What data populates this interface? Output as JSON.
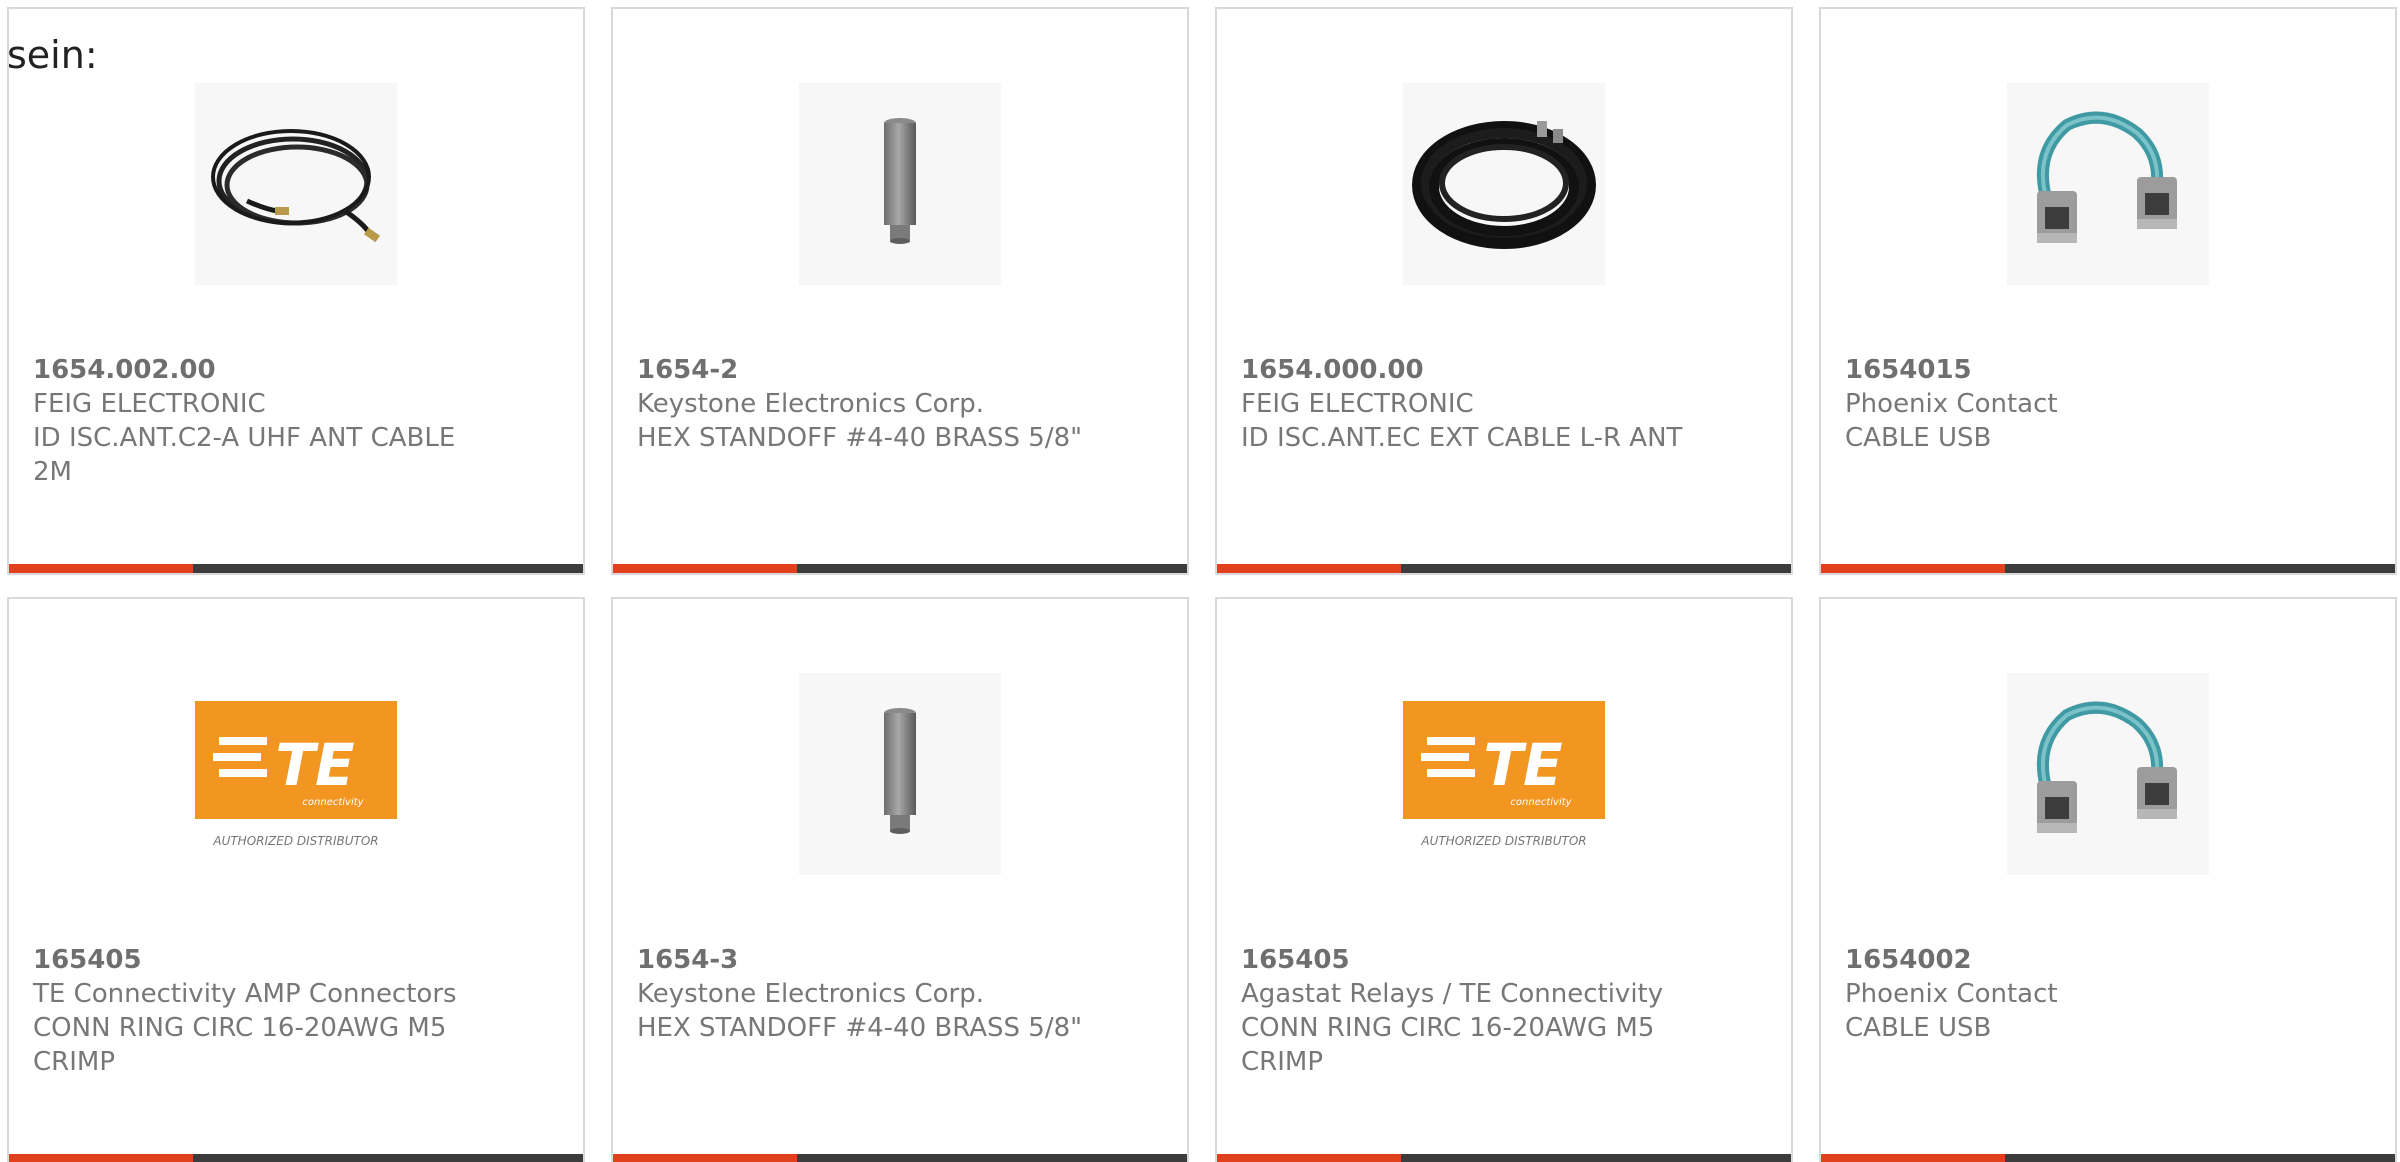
{
  "lead_text": "sein:",
  "colors": {
    "accent_bar": "#e0401b",
    "bar": "#3c3c3c",
    "card_border": "#d9d9d9",
    "text": "#777777"
  },
  "products": [
    {
      "part_number": "1654.002.00",
      "manufacturer": "FEIG ELECTRONIC",
      "description": "ID ISC.ANT.C2-A UHF ANT CABLE 2M",
      "image": "coiled-cable-thin-icon"
    },
    {
      "part_number": "1654-2",
      "manufacturer": "Keystone Electronics Corp.",
      "description": "HEX STANDOFF #4-40 BRASS 5/8\"",
      "image": "hex-standoff-icon"
    },
    {
      "part_number": "1654.000.00",
      "manufacturer": "FEIG ELECTRONIC",
      "description": "ID ISC.ANT.EC EXT CABLE L-R ANT",
      "image": "coiled-cable-thick-icon"
    },
    {
      "part_number": "1654015",
      "manufacturer": "Phoenix Contact",
      "description": "CABLE USB",
      "image": "usb-cable-icon"
    },
    {
      "part_number": "165405",
      "manufacturer": "TE Connectivity AMP Connectors",
      "description": "CONN RING CIRC 16-20AWG M5 CRIMP",
      "image": "te-logo",
      "logo_text": {
        "brand": "TE",
        "sub": "connectivity",
        "caption": "AUTHORIZED DISTRIBUTOR"
      }
    },
    {
      "part_number": "1654-3",
      "manufacturer": "Keystone Electronics Corp.",
      "description": "HEX STANDOFF #4-40 BRASS 5/8\"",
      "image": "hex-standoff-icon"
    },
    {
      "part_number": "165405",
      "manufacturer": "Agastat Relays / TE Connectivity",
      "description": "CONN RING CIRC 16-20AWG M5 CRIMP",
      "image": "te-logo",
      "logo_text": {
        "brand": "TE",
        "sub": "connectivity",
        "caption": "AUTHORIZED DISTRIBUTOR"
      }
    },
    {
      "part_number": "1654002",
      "manufacturer": "Phoenix Contact",
      "description": "CABLE USB",
      "image": "usb-cable-icon"
    }
  ]
}
